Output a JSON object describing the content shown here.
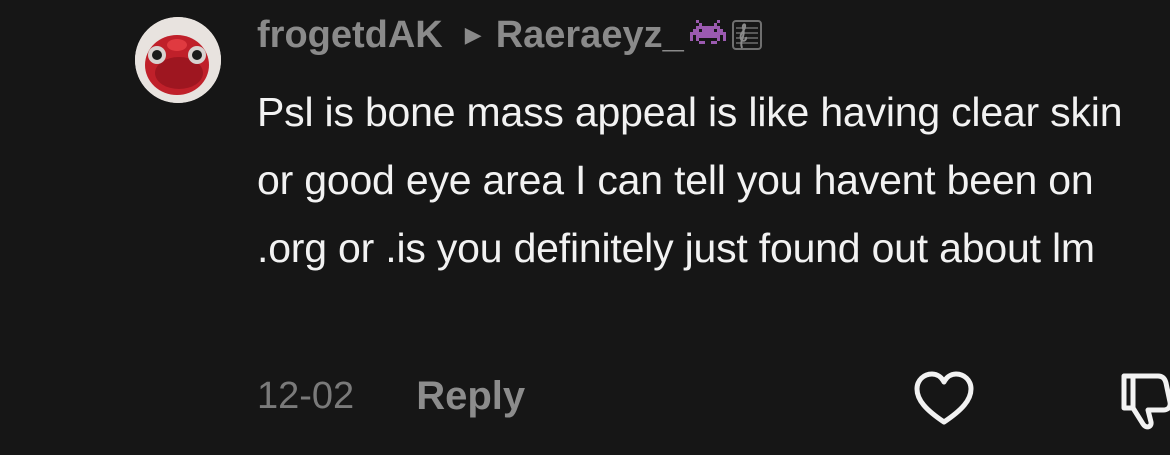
{
  "comment": {
    "author": "frogetdAK",
    "reply_to": "Raeraeyz_",
    "reply_arrow": "▶",
    "emojis": [
      "space-invader-icon",
      "music-score-icon"
    ],
    "text": "Psl is bone mass appeal is like having clear skin or good eye area I can tell you havent been on .org or .is you definitely just found out about lm",
    "date": "12-02",
    "reply_label": "Reply",
    "icons": {
      "like": "heart-outline-icon",
      "dislike": "thumbs-down-outline-icon"
    },
    "colors": {
      "background": "#161616",
      "username": "#8a8a8a",
      "body": "#f2f2f2",
      "meta": "#7a7a7a",
      "emoji": "#9b5ab0"
    }
  }
}
